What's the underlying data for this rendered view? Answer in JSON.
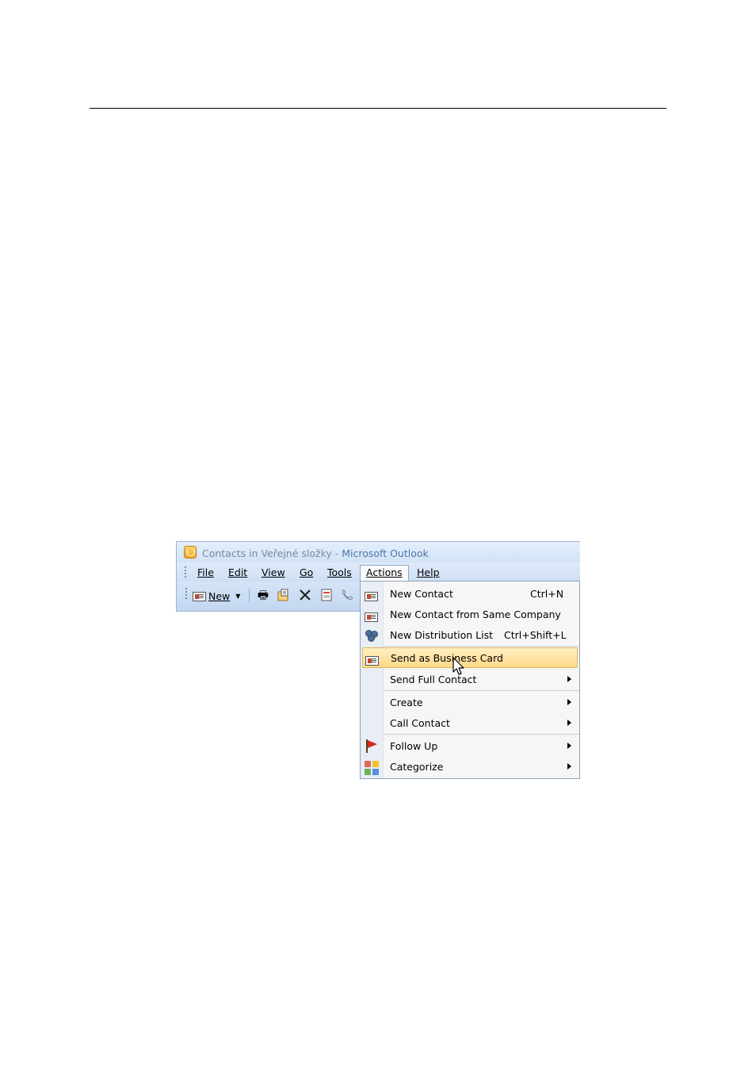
{
  "window": {
    "title_doc": "Contacts in Veřejné složky",
    "title_sep": " - ",
    "title_app": "Microsoft Outlook"
  },
  "menubar": {
    "items": [
      {
        "label": "File"
      },
      {
        "label": "Edit"
      },
      {
        "label": "View"
      },
      {
        "label": "Go"
      },
      {
        "label": "Tools"
      },
      {
        "label": "Actions",
        "active": true
      },
      {
        "label": "Help"
      }
    ]
  },
  "toolbar": {
    "new_label": "New",
    "icons": [
      "print-icon",
      "move-to-folder-icon",
      "delete-icon",
      "address-book-icon",
      "phone-icon"
    ]
  },
  "actions_menu": {
    "items": [
      {
        "label": "New Contact",
        "shortcut": "Ctrl+N",
        "icon": "contact-card-icon"
      },
      {
        "label": "New Contact from Same Company",
        "shortcut": "",
        "icon": "contact-card-icon"
      },
      {
        "label": "New Distribution List",
        "shortcut": "Ctrl+Shift+L",
        "icon": "distribution-list-icon"
      },
      {
        "label": "Send as Business Card",
        "shortcut": "",
        "icon": "business-card-icon",
        "highlighted": true
      },
      {
        "label": "Send Full Contact",
        "submenu": true
      },
      {
        "label": "Create",
        "submenu": true
      },
      {
        "label": "Call Contact",
        "submenu": true
      },
      {
        "label": "Follow Up",
        "submenu": true,
        "icon": "flag-icon"
      },
      {
        "label": "Categorize",
        "submenu": true,
        "icon": "categorize-icon"
      }
    ]
  },
  "colors": {
    "highlight": "#ffd889",
    "title_app": "#5176a8",
    "flag": "#d32b1e"
  }
}
